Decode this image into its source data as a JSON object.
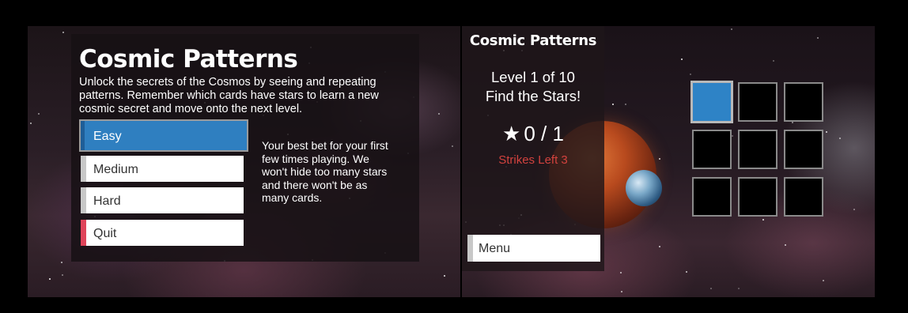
{
  "colors": {
    "accent_blue": "#2f7fc0",
    "quit_red": "#e0445a",
    "strikes_red": "#d2423e"
  },
  "menu_screen": {
    "title": "Cosmic Patterns",
    "description": "Unlock the secrets of the Cosmos by seeing and repeating patterns. Remember which cards have stars to learn a new cosmic secret and move onto the next level.",
    "buttons": [
      {
        "label": "Easy",
        "selected": true
      },
      {
        "label": "Medium",
        "selected": false
      },
      {
        "label": "Hard",
        "selected": false
      },
      {
        "label": "Quit",
        "selected": false
      }
    ],
    "difficulty_description": "Your best bet for your first few times playing. We won't hide too many stars and there won't be as many cards."
  },
  "game_screen": {
    "title": "Cosmic Patterns",
    "level": "Level 1 of 10",
    "goal": "Find the Stars!",
    "star_icon": "star-icon",
    "score": "0 / 1",
    "strikes": "Strikes Left 3",
    "menu_label": "Menu",
    "cards": [
      {
        "active": true
      },
      {
        "active": false
      },
      {
        "active": false
      },
      {
        "active": false
      },
      {
        "active": false
      },
      {
        "active": false
      },
      {
        "active": false
      },
      {
        "active": false
      },
      {
        "active": false
      }
    ]
  }
}
